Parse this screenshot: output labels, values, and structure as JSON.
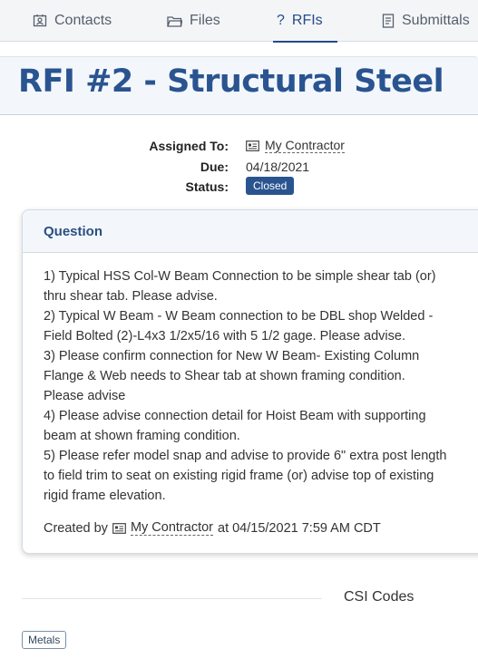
{
  "tabs": [
    {
      "label": "Contacts",
      "icon": "contact-card-icon"
    },
    {
      "label": "Files",
      "icon": "folder-icon"
    },
    {
      "label": "RFIs",
      "icon": "question-icon",
      "active": true
    },
    {
      "label": "Submittals",
      "icon": "document-icon"
    }
  ],
  "title": "RFI #2 - Structural Steel",
  "meta": {
    "assigned_label": "Assigned To:",
    "assigned_value": "My Contractor",
    "due_label": "Due:",
    "due_value": "04/18/2021",
    "status_label": "Status:",
    "status_value": "Closed"
  },
  "question": {
    "header": "Question",
    "lines": [
      "1) Typical HSS Col-W Beam Connection to be simple shear tab (or)",
      "thru shear tab. Please advise.",
      "2) Typical W Beam - W Beam connection to be DBL shop Welded -",
      "Field Bolted (2)-L4x3 1/2x5/16 with 5 1/2 gage. Please advise.",
      "3) Please confirm connection for New W Beam- Existing Column",
      "Flange & Web needs to Shear tab at shown framing condition.",
      "Please advise",
      "4) Please advise connection detail for Hoist Beam with supporting",
      "beam at shown framing condition.",
      "5) Please refer model snap and advise to provide 6\" extra post length",
      "to field trim to seat on existing rigid frame (or) advise top of existing",
      "rigid frame elevation."
    ],
    "created_prefix": "Created by",
    "created_by": "My Contractor",
    "created_suffix": "at 04/15/2021 7:59 AM CDT"
  },
  "csi": {
    "title": "CSI Codes",
    "tags": [
      "Metals"
    ]
  },
  "colors": {
    "accent": "#2a5490",
    "tab_active": "#234b8a",
    "header_bg": "#f3f7fc"
  }
}
